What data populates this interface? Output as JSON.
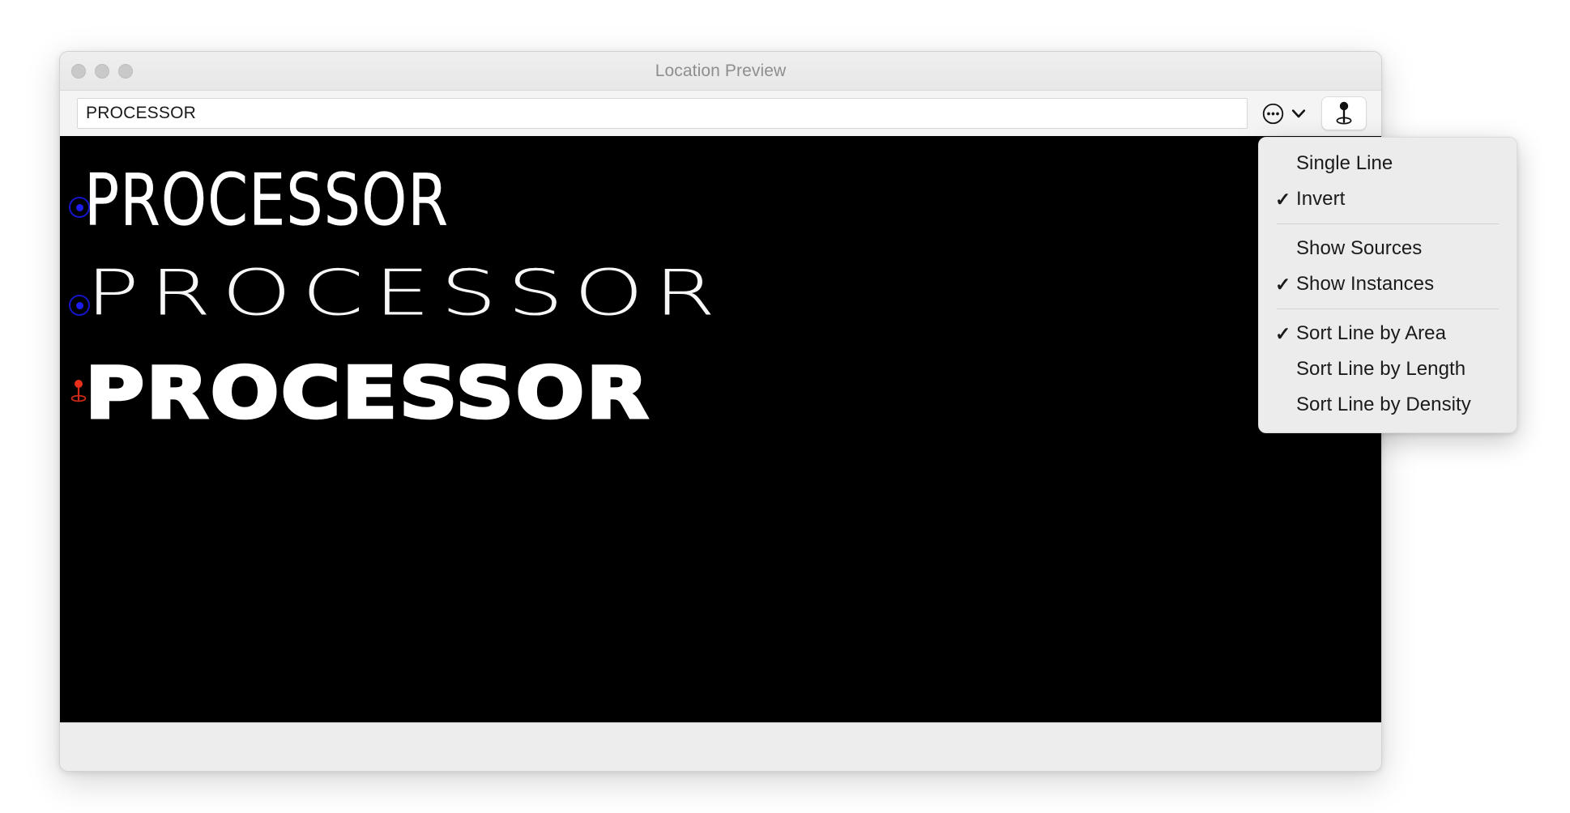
{
  "window": {
    "title": "Location Preview",
    "traffic_lights": [
      "close",
      "minimize",
      "zoom"
    ]
  },
  "toolbar": {
    "search_value": "PROCESSOR",
    "search_placeholder": "",
    "options_icon": "ellipsis-circle-icon",
    "chevron_icon": "chevron-down-icon",
    "pin_icon": "location-pin-icon"
  },
  "preview": {
    "background": "#000000",
    "text_color": "#ffffff",
    "lines": [
      {
        "text": "PROCESSOR",
        "style": "thin-condensed",
        "marker": "ring"
      },
      {
        "text": "PROCESSOR",
        "style": "thin-extended",
        "marker": "ring"
      },
      {
        "text": "PROCESSOR",
        "style": "black-extended",
        "marker": "pin"
      }
    ],
    "marker_ring_color": "#1d1df0",
    "marker_pin_color": "#e03020"
  },
  "menu": {
    "items": [
      {
        "label": "Single Line",
        "checked": false
      },
      {
        "label": "Invert",
        "checked": true
      },
      {
        "label": "separator",
        "checked": false
      },
      {
        "label": "Show Sources",
        "checked": false
      },
      {
        "label": "Show Instances",
        "checked": true
      },
      {
        "label": "separator",
        "checked": false
      },
      {
        "label": "Sort Line by Area",
        "checked": true
      },
      {
        "label": "Sort Line by Length",
        "checked": false
      },
      {
        "label": "Sort Line by Density",
        "checked": false
      }
    ],
    "check_glyph": "✓"
  }
}
